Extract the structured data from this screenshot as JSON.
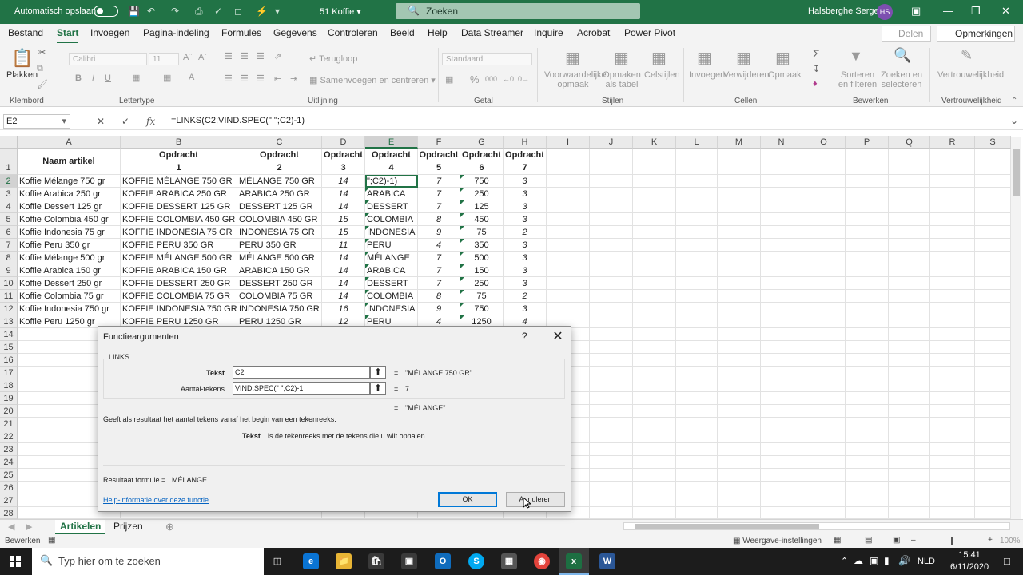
{
  "titlebar": {
    "autosave_label": "Automatisch opslaan",
    "filename": "51 Koffie",
    "search_placeholder": "Zoeken",
    "user_name": "Halsberghe Serge",
    "user_initials": "HS"
  },
  "menu": {
    "items": [
      "Bestand",
      "Start",
      "Invoegen",
      "Pagina-indeling",
      "Formules",
      "Gegevens",
      "Controleren",
      "Beeld",
      "Help",
      "Data Streamer",
      "Inquire",
      "Acrobat",
      "Power Pivot"
    ],
    "active": "Start",
    "share": "Delen",
    "comments": "Opmerkingen"
  },
  "ribbon": {
    "paste": "Plakken",
    "font_name": "Calibri",
    "font_size": "11",
    "wrap": "Terugloop",
    "merge": "Samenvoegen en centreren",
    "number_format": "Standaard",
    "cond_format": "Voorwaardelijke opmaak",
    "format_table": "Opmaken als tabel",
    "cell_styles": "Celstijlen",
    "insert": "Invoegen",
    "delete": "Verwijderen",
    "format": "Opmaak",
    "sort_filter": "Sorteren en filteren",
    "find_select": "Zoeken en selecteren",
    "sensitivity": "Vertrouwelijkheid",
    "groups": [
      "Klembord",
      "Lettertype",
      "Uitlijning",
      "Getal",
      "Stijlen",
      "Cellen",
      "Bewerken",
      "Vertrouwelijkheid"
    ]
  },
  "formula_bar": {
    "name_box": "E2",
    "formula": "=LINKS(C2;VIND.SPEC(\" \";C2)-1)"
  },
  "sheet": {
    "columns": [
      "A",
      "B",
      "C",
      "D",
      "E",
      "F",
      "G",
      "H",
      "I",
      "J",
      "K",
      "L",
      "M",
      "N",
      "O",
      "P",
      "Q",
      "R",
      "S"
    ],
    "row_numbers": [
      "1",
      "2",
      "3",
      "4",
      "5",
      "6",
      "7",
      "8",
      "9",
      "10",
      "11",
      "12",
      "13",
      "14",
      "15",
      "16",
      "17",
      "18",
      "19",
      "20",
      "21",
      "22",
      "23",
      "24",
      "25",
      "26",
      "27",
      "28"
    ],
    "header_a": "Naam artikel",
    "headers_top": [
      "Opdracht",
      "Opdracht",
      "Opdracht",
      "Opdracht",
      "Opdracht",
      "Opdracht",
      "Opdracht"
    ],
    "headers_bottom": [
      "1",
      "2",
      "3",
      "4",
      "5",
      "6",
      "7"
    ],
    "rows": [
      [
        "Koffie Mélange 750 gr",
        "KOFFIE MÉLANGE 750 GR",
        "MÉLANGE 750 GR",
        "14",
        "\";C2)-1)",
        "7",
        "750",
        "3"
      ],
      [
        "Koffie Arabica 250 gr",
        "KOFFIE ARABICA 250 GR",
        "ARABICA 250 GR",
        "14",
        "ARABICA",
        "7",
        "250",
        "3"
      ],
      [
        "Koffie Dessert 125 gr",
        "KOFFIE DESSERT 125 GR",
        "DESSERT 125 GR",
        "14",
        "DESSERT",
        "7",
        "125",
        "3"
      ],
      [
        "Koffie Colombia 450 gr",
        "KOFFIE COLOMBIA 450 GR",
        "COLOMBIA 450 GR",
        "15",
        "COLOMBIA",
        "8",
        "450",
        "3"
      ],
      [
        "Koffie Indonesia 75 gr",
        "KOFFIE INDONESIA 75 GR",
        "INDONESIA 75 GR",
        "15",
        "INDONESIA",
        "9",
        "75",
        "2"
      ],
      [
        "Koffie Peru 350 gr",
        "KOFFIE PERU 350 GR",
        "PERU 350 GR",
        "11",
        "PERU",
        "4",
        "350",
        "3"
      ],
      [
        "Koffie Mélange 500 gr",
        "KOFFIE MÉLANGE 500 GR",
        "MÉLANGE 500 GR",
        "14",
        "MÉLANGE",
        "7",
        "500",
        "3"
      ],
      [
        "Koffie Arabica 150 gr",
        "KOFFIE ARABICA 150 GR",
        "ARABICA 150 GR",
        "14",
        "ARABICA",
        "7",
        "150",
        "3"
      ],
      [
        "Koffie Dessert 250 gr",
        "KOFFIE DESSERT 250 GR",
        "DESSERT 250 GR",
        "14",
        "DESSERT",
        "7",
        "250",
        "3"
      ],
      [
        "Koffie Colombia 75 gr",
        "KOFFIE COLOMBIA 75 GR",
        "COLOMBIA 75 GR",
        "14",
        "COLOMBIA",
        "8",
        "75",
        "2"
      ],
      [
        "Koffie Indonesia 750 gr",
        "KOFFIE INDONESIA 750 GR",
        "INDONESIA 750 GR",
        "16",
        "INDONESIA",
        "9",
        "750",
        "3"
      ],
      [
        "Koffie Peru 1250 gr",
        "KOFFIE PERU 1250 GR",
        "PERU 1250 GR",
        "12",
        "PERU",
        "4",
        "1250",
        "4"
      ]
    ]
  },
  "sheet_tabs": [
    "Artikelen",
    "Prijzen"
  ],
  "status": {
    "mode": "Bewerken",
    "display_settings": "Weergave-instellingen",
    "zoom": "100%"
  },
  "dialog": {
    "title": "Functieargumenten",
    "help": "?",
    "function_name": "LINKS",
    "arg1_label": "Tekst",
    "arg1_value": "C2",
    "arg1_result": "\"MÉLANGE 750 GR\"",
    "arg2_label": "Aantal-tekens",
    "arg2_value": "VIND.SPEC(\" \";C2)-1",
    "arg2_result": "7",
    "total_result": "\"MÉLANGE\"",
    "description": "Geeft als resultaat het aantal tekens vanaf het begin van een tekenreeks.",
    "arg_help_name": "Tekst",
    "arg_help_text": "is de tekenreeks met de tekens die u wilt ophalen.",
    "result_label": "Resultaat formule =",
    "result_value": "MÉLANGE",
    "help_link": "Help-informatie over deze functie",
    "ok": "OK",
    "cancel": "Annuleren",
    "equals": "="
  },
  "taskbar": {
    "search_placeholder": "Typ hier om te zoeken",
    "language": "NLD",
    "time": "15:41",
    "date": "6/11/2020"
  },
  "colors": {
    "excel_green": "#217346",
    "accent_blue": "#0078d7"
  }
}
